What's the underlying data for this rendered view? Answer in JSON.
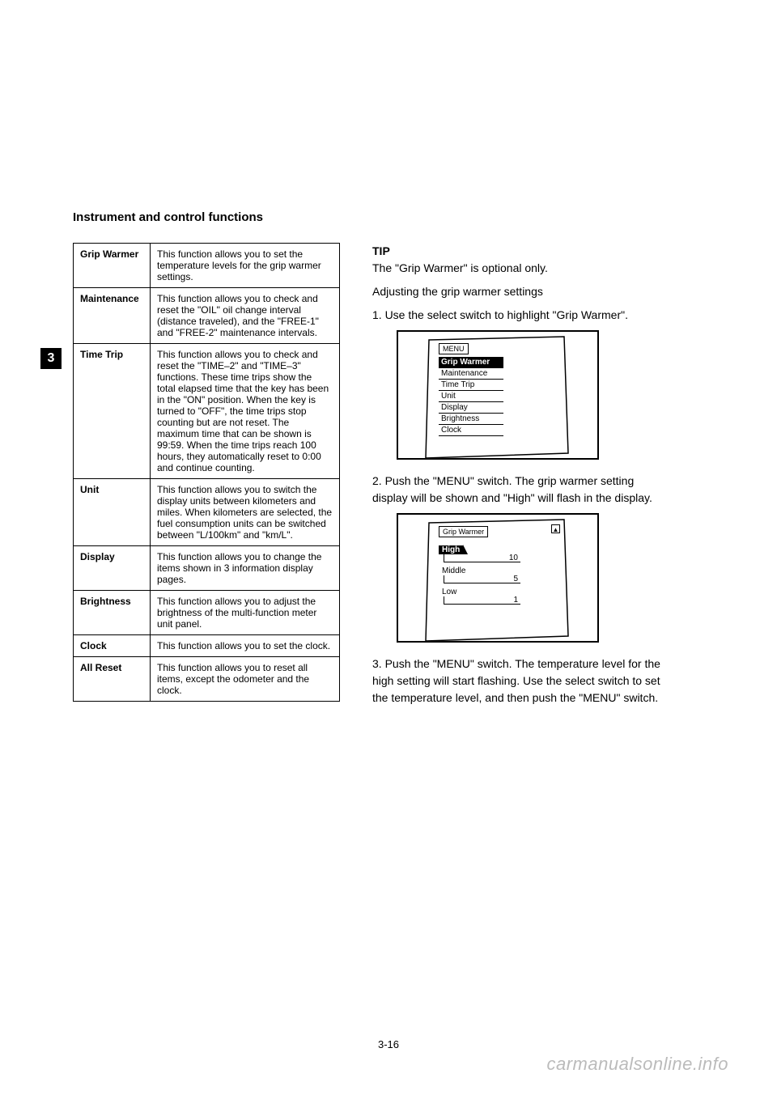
{
  "header": {
    "title": "Instrument and control functions"
  },
  "section_number": "3",
  "table": {
    "rows": [
      {
        "name": "Grip Warmer",
        "desc": "This function allows you to set the temperature levels for the grip warmer settings."
      },
      {
        "name": "Maintenance",
        "desc": "This function allows you to check and reset the \"OIL\" oil change interval (distance traveled), and the \"FREE-1\" and \"FREE-2\" maintenance intervals."
      },
      {
        "name": "Time Trip",
        "desc": "This function allows you to check and reset the \"TIME–2\" and \"TIME–3\" functions. These time trips show the total elapsed time that the key has been in the \"ON\" position. When the key is turned to \"OFF\", the time trips stop counting but are not reset. The maximum time that can be shown is 99:59. When the time trips reach 100 hours, they automatically reset to 0:00 and continue counting."
      },
      {
        "name": "Unit",
        "desc": "This function allows you to switch the display units between kilometers and miles. When kilometers are selected, the fuel consumption units can be switched between \"L/100km\" and \"km/L\"."
      },
      {
        "name": "Display",
        "desc": "This function allows you to change the items shown in 3 information display pages."
      },
      {
        "name": "Brightness",
        "desc": "This function allows you to adjust the brightness of the multi-function meter unit panel."
      },
      {
        "name": "Clock",
        "desc": "This function allows you to set the clock."
      },
      {
        "name": "All Reset",
        "desc": "This function allows you to reset all items, except the odometer and the clock."
      }
    ]
  },
  "right": {
    "tip_label": "TIP",
    "tip_text": "The \"Grip Warmer\" is optional only.",
    "para1": "Adjusting the grip warmer settings",
    "para2": "1. Use the select switch to highlight \"Grip Warmer\".",
    "para3": "2. Push the \"MENU\" switch. The grip warmer setting display will be shown and \"High\" will flash in the display.",
    "para4": "3. Push the \"MENU\" switch. The temperature level for the high setting will start flashing. Use the select switch to set the temperature level, and then push the \"MENU\" switch.",
    "menu_screen": {
      "title": "MENU",
      "items": [
        "Grip Warmer",
        "Maintenance",
        "Time Trip",
        "Unit",
        "Display",
        "Brightness",
        "Clock"
      ],
      "selected_index": 0
    },
    "grip_screen": {
      "title": "Grip Warmer",
      "levels": [
        {
          "name": "High",
          "value": "10",
          "selected": true
        },
        {
          "name": "Middle",
          "value": "5",
          "selected": false
        },
        {
          "name": "Low",
          "value": "1",
          "selected": false
        }
      ]
    }
  },
  "page_number": "3-16",
  "watermark": "carmanualsonline.info"
}
